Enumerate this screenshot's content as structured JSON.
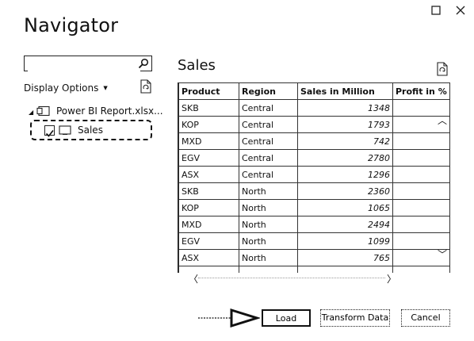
{
  "window": {
    "title": "Navigator"
  },
  "search": {
    "placeholder": "",
    "value": ""
  },
  "display_options": {
    "label": "Display Options"
  },
  "tree": {
    "file_label": "Power BI Report.xlsx...",
    "item_label": "Sales",
    "item_checked": true
  },
  "preview": {
    "title": "Sales",
    "columns": [
      "Product",
      "Region",
      "Sales in Million",
      "Profit in %"
    ],
    "rows": [
      [
        "SKB",
        "Central",
        "1348",
        ""
      ],
      [
        "KOP",
        "Central",
        "1793",
        ""
      ],
      [
        "MXD",
        "Central",
        "742",
        ""
      ],
      [
        "EGV",
        "Central",
        "2780",
        ""
      ],
      [
        "ASX",
        "Central",
        "1296",
        ""
      ],
      [
        "SKB",
        "North",
        "2360",
        ""
      ],
      [
        "KOP",
        "North",
        "1065",
        ""
      ],
      [
        "MXD",
        "North",
        "2494",
        ""
      ],
      [
        "EGV",
        "North",
        "1099",
        ""
      ],
      [
        "ASX",
        "North",
        "765",
        ""
      ],
      [
        "",
        "",
        "",
        ""
      ]
    ]
  },
  "buttons": {
    "load": "Load",
    "transform": "Transform Data",
    "cancel": "Cancel"
  },
  "icons": {
    "maximize": "maximize-icon",
    "close": "close-icon",
    "search": "search-icon",
    "refresh": "refresh-icon",
    "file": "excel-file-icon",
    "table": "table-icon",
    "arrow": "pointer-arrow-icon"
  }
}
